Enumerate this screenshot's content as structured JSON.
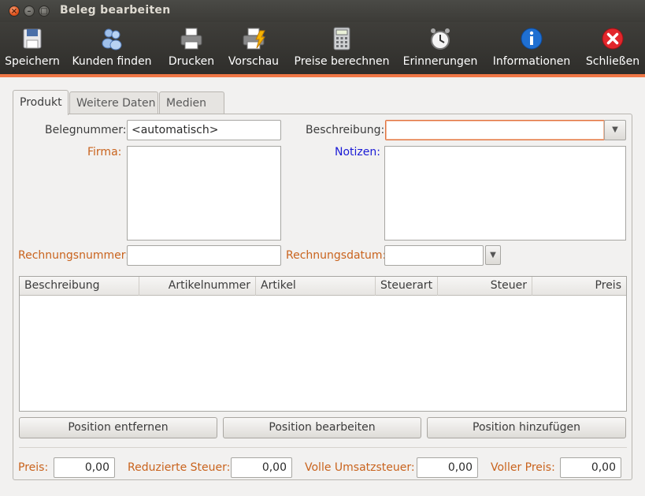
{
  "window": {
    "title": "Beleg bearbeiten",
    "controls": [
      "×",
      "–",
      "□"
    ]
  },
  "toolbar": {
    "items": [
      {
        "label": "Speichern",
        "icon": "floppy-disk-icon"
      },
      {
        "label": "Kunden finden",
        "icon": "people-icon"
      },
      {
        "label": "Drucken",
        "icon": "printer-icon"
      },
      {
        "label": "Vorschau",
        "icon": "print-preview-icon"
      },
      {
        "label": "Preise berechnen",
        "icon": "calculator-icon"
      },
      {
        "label": "Erinnerungen",
        "icon": "alarm-clock-icon"
      },
      {
        "label": "Informationen",
        "icon": "info-icon"
      },
      {
        "label": "Schließen",
        "icon": "close-icon"
      }
    ],
    "accent": "#f07746"
  },
  "tabs": [
    {
      "label": "Produkt",
      "active": true
    },
    {
      "label": "Weitere Daten",
      "active": false
    },
    {
      "label": "Medien",
      "active": false
    }
  ],
  "form": {
    "belegnummer_label": "Belegnummer:",
    "belegnummer_value": "<automatisch>",
    "beschreibung_label": "Beschreibung:",
    "beschreibung_value": "",
    "firma_label": "Firma:",
    "notizen_label": "Notizen:",
    "rechnungsnummer_label": "Rechnungsnummer:",
    "rechnungsnummer_value": "",
    "rechnungsdatum_label": "Rechnungsdatum:",
    "rechnungsdatum_value": ""
  },
  "table": {
    "columns": [
      "Beschreibung",
      "Artikelnummer",
      "Artikel",
      "Steuerart",
      "Steuer",
      "Preis"
    ],
    "rows": []
  },
  "actions": {
    "remove": "Position entfernen",
    "edit": "Position bearbeiten",
    "add": "Position hinzufügen"
  },
  "totals": {
    "preis_label": "Preis:",
    "preis_value": "0,00",
    "reduziert_label": "Reduzierte Steuer:",
    "reduziert_value": "0,00",
    "volle_label": "Volle Umsatzsteuer:",
    "volle_value": "0,00",
    "voller_preis_label": "Voller Preis:",
    "voller_preis_value": "0,00"
  },
  "colors": {
    "label_orange": "#c9631d",
    "label_blue": "#1b1bd6",
    "focus_border": "#e0733f"
  }
}
